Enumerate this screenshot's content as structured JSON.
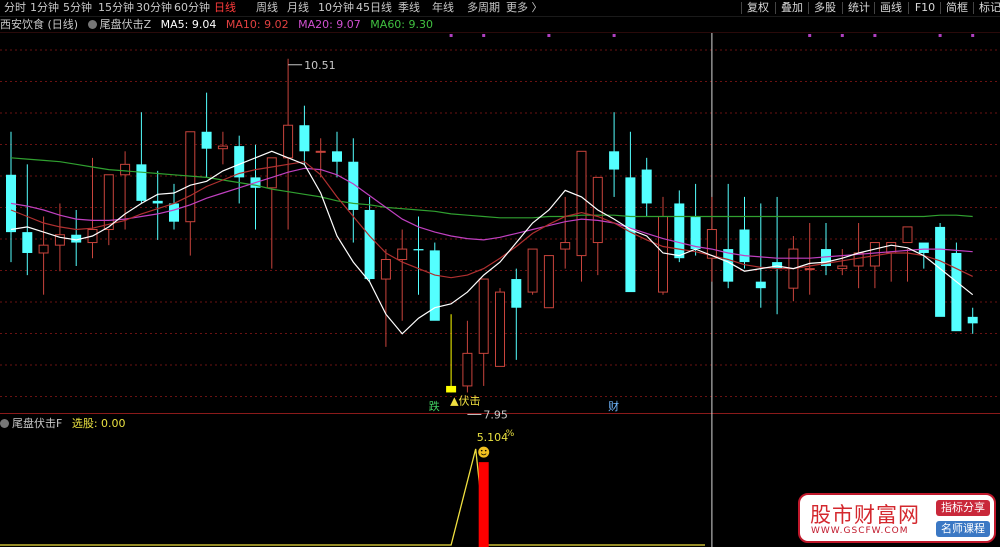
{
  "toolbar": {
    "periods": [
      "分时",
      "1分钟",
      "5分钟",
      "15分钟",
      "30分钟",
      "60分钟",
      "日线",
      "周线",
      "月线",
      "10分钟",
      "45日线",
      "季线",
      "年线",
      "多周期",
      "更多 〉"
    ],
    "active_period": "日线",
    "tools": [
      "复权",
      "叠加",
      "多股",
      "统计",
      "画线",
      "F10",
      "简框",
      "标记"
    ]
  },
  "main_title": {
    "stock": "西安饮食 (日线)",
    "indicator": "尾盘伏击Z",
    "ma5": "MA5: 9.04",
    "ma10": "MA10: 9.02",
    "ma20": "MA20: 9.07",
    "ma60": "MA60: 9.30"
  },
  "sub_title": {
    "indicator": "尾盘伏击F",
    "xg": "选股: 0.00"
  },
  "annotations": {
    "high": "10.51",
    "low": "7.95",
    "signal": "▲伏击",
    "tag_die": "跌",
    "tag_cai": "财",
    "sub_value": "5.104",
    "sub_unit": "%"
  },
  "colors": {
    "up": "#c8443c",
    "down": "#54ffff",
    "signal_bar": "#ffff00",
    "ma5": "#ffffff",
    "ma10": "#b03030",
    "ma20": "#c040c0",
    "ma60": "#30a030",
    "sub_line": "#f0e040",
    "sub_bar": "#ff0000",
    "grid": "#6a1212"
  },
  "logo": {
    "main": "股市财富网",
    "url": "WWW.GSCFW.COM",
    "badge1": "指标分享",
    "badge2": "名师课程"
  },
  "chart_data": {
    "type": "candlestick",
    "x": [
      "c01",
      "c02",
      "c03",
      "c04",
      "c05",
      "c06",
      "c07",
      "c08",
      "c09",
      "c10",
      "c11",
      "c12",
      "c13",
      "c14",
      "c15",
      "c16",
      "c17",
      "c18",
      "c19",
      "c20",
      "c21",
      "c22",
      "c23",
      "c24",
      "c25",
      "c26",
      "c27",
      "c28",
      "c29",
      "c30",
      "c31",
      "c32",
      "c33",
      "c34",
      "c35",
      "c36",
      "c37",
      "c38",
      "c39",
      "c40",
      "c41",
      "c42",
      "c43",
      "c44",
      "c45",
      "c46",
      "c47",
      "c48",
      "c49",
      "c50",
      "c51",
      "c52",
      "c53",
      "c54",
      "c55",
      "c56",
      "c57",
      "c58",
      "c59",
      "c60"
    ],
    "open": [
      9.62,
      9.18,
      9.02,
      9.08,
      9.16,
      9.1,
      9.2,
      9.62,
      9.7,
      9.42,
      9.4,
      9.26,
      9.95,
      9.82,
      9.84,
      9.6,
      9.52,
      9.75,
      10.0,
      9.8,
      9.8,
      9.72,
      9.35,
      8.82,
      8.97,
      9.05,
      9.04,
      7.95,
      8.0,
      8.25,
      8.15,
      8.82,
      8.72,
      8.6,
      9.05,
      9.0,
      9.1,
      9.8,
      9.6,
      9.66,
      8.72,
      9.4,
      9.3,
      8.98,
      9.05,
      9.2,
      8.8,
      8.95,
      8.75,
      8.9,
      9.05,
      8.9,
      8.92,
      8.92,
      9.02,
      9.1,
      9.1,
      9.22,
      9.02,
      8.53
    ],
    "high": [
      9.95,
      9.7,
      9.3,
      9.4,
      9.35,
      9.75,
      9.5,
      9.8,
      10.1,
      9.65,
      9.55,
      9.5,
      10.25,
      9.95,
      9.92,
      9.85,
      9.75,
      10.51,
      10.15,
      9.9,
      9.95,
      9.9,
      9.45,
      9.05,
      9.2,
      9.3,
      9.1,
      8.55,
      8.5,
      8.75,
      8.75,
      8.9,
      8.85,
      9.0,
      9.45,
      9.25,
      9.55,
      10.1,
      9.95,
      9.75,
      9.45,
      9.5,
      9.55,
      9.45,
      9.55,
      9.45,
      9.4,
      9.45,
      9.15,
      9.25,
      9.25,
      9.05,
      9.25,
      9.0,
      9.02,
      9.05,
      9.05,
      9.25,
      9.1,
      8.6
    ],
    "low": [
      8.95,
      8.85,
      8.7,
      8.88,
      8.92,
      8.98,
      9.08,
      9.2,
      9.4,
      9.12,
      9.2,
      9.0,
      9.6,
      9.7,
      9.4,
      9.2,
      8.9,
      9.2,
      9.7,
      9.6,
      9.6,
      9.1,
      8.8,
      8.3,
      8.5,
      8.7,
      8.8,
      7.95,
      7.95,
      8.0,
      8.15,
      8.2,
      8.7,
      8.65,
      8.9,
      8.8,
      8.85,
      9.45,
      9.2,
      9.3,
      8.7,
      8.95,
      9.0,
      8.8,
      8.75,
      8.9,
      8.6,
      8.55,
      8.65,
      8.7,
      8.85,
      8.85,
      8.75,
      8.75,
      8.8,
      8.8,
      8.9,
      8.9,
      8.55,
      8.4
    ],
    "close": [
      9.18,
      9.02,
      9.08,
      9.16,
      9.1,
      9.2,
      9.62,
      9.7,
      9.42,
      9.4,
      9.26,
      9.95,
      9.82,
      9.84,
      9.6,
      9.52,
      9.75,
      10.0,
      9.8,
      9.8,
      9.72,
      9.35,
      8.82,
      8.97,
      9.05,
      9.04,
      8.5,
      8.0,
      8.25,
      8.82,
      8.72,
      8.6,
      9.05,
      9.0,
      9.1,
      9.8,
      9.6,
      9.66,
      8.72,
      9.4,
      9.3,
      8.98,
      9.05,
      9.2,
      8.8,
      8.95,
      8.75,
      8.9,
      9.05,
      8.9,
      8.92,
      8.92,
      9.02,
      9.1,
      9.1,
      9.22,
      9.02,
      8.53,
      8.42,
      8.48
    ],
    "ma5": [
      9.2,
      9.22,
      9.18,
      9.14,
      9.12,
      9.15,
      9.22,
      9.32,
      9.4,
      9.47,
      9.48,
      9.54,
      9.57,
      9.65,
      9.7,
      9.75,
      9.8,
      9.75,
      9.7,
      9.48,
      9.15,
      8.95,
      8.8,
      8.55,
      8.4,
      8.52,
      8.6,
      8.63,
      8.72,
      8.85,
      8.95,
      9.1,
      9.25,
      9.35,
      9.5,
      9.45,
      9.35,
      9.28,
      9.2,
      9.15,
      9.02,
      9.0,
      9.05,
      9.0,
      8.95,
      8.88,
      8.9,
      8.92,
      8.9,
      8.94,
      8.95,
      8.98,
      9.02,
      9.05,
      9.08,
      9.06,
      9.0,
      8.9,
      8.8,
      8.7
    ],
    "ma10": [
      9.35,
      9.3,
      9.25,
      9.22,
      9.2,
      9.21,
      9.24,
      9.27,
      9.32,
      9.36,
      9.4,
      9.46,
      9.53,
      9.58,
      9.63,
      9.66,
      9.68,
      9.7,
      9.72,
      9.62,
      9.45,
      9.3,
      9.15,
      9.02,
      8.95,
      8.9,
      8.85,
      8.83,
      8.85,
      8.9,
      8.98,
      9.07,
      9.17,
      9.24,
      9.3,
      9.33,
      9.3,
      9.25,
      9.18,
      9.12,
      9.07,
      9.05,
      9.03,
      9.0,
      8.97,
      8.93,
      8.91,
      8.9,
      8.9,
      8.92,
      8.94,
      8.96,
      8.98,
      9.0,
      9.02,
      9.02,
      9.0,
      8.96,
      8.9,
      8.84
    ],
    "ma20": [
      9.4,
      9.38,
      9.35,
      9.31,
      9.28,
      9.27,
      9.27,
      9.28,
      9.3,
      9.32,
      9.35,
      9.39,
      9.44,
      9.48,
      9.52,
      9.56,
      9.6,
      9.64,
      9.67,
      9.66,
      9.62,
      9.55,
      9.46,
      9.37,
      9.28,
      9.22,
      9.18,
      9.15,
      9.13,
      9.12,
      9.14,
      9.17,
      9.2,
      9.23,
      9.26,
      9.28,
      9.27,
      9.25,
      9.21,
      9.17,
      9.13,
      9.1,
      9.07,
      9.05,
      9.02,
      9.0,
      8.99,
      8.98,
      8.98,
      8.98,
      8.99,
      9.0,
      9.01,
      9.02,
      9.03,
      9.04,
      9.05,
      9.05,
      9.04,
      9.03
    ],
    "ma60": [
      9.75,
      9.74,
      9.73,
      9.72,
      9.7,
      9.68,
      9.66,
      9.65,
      9.64,
      9.63,
      9.62,
      9.61,
      9.6,
      9.58,
      9.56,
      9.54,
      9.51,
      9.49,
      9.47,
      9.45,
      9.42,
      9.4,
      9.39,
      9.37,
      9.36,
      9.35,
      9.34,
      9.32,
      9.31,
      9.3,
      9.29,
      9.29,
      9.29,
      9.3,
      9.3,
      9.31,
      9.31,
      9.31,
      9.3,
      9.3,
      9.3,
      9.3,
      9.3,
      9.3,
      9.3,
      9.3,
      9.3,
      9.3,
      9.3,
      9.3,
      9.3,
      9.3,
      9.3,
      9.3,
      9.3,
      9.3,
      9.3,
      9.31,
      9.31,
      9.3
    ],
    "signal_index": 27,
    "crosshair_index": 43,
    "high_index": 17,
    "low_index": 28,
    "tag_die_index": 26,
    "tag_cai_index": 37,
    "markers_top": [
      27,
      29,
      33,
      37,
      49,
      51,
      53,
      57,
      59,
      61
    ],
    "y_range": [
      7.8,
      10.7
    ],
    "sub_line": {
      "x_start": 27,
      "x_peak": 29,
      "x_end": 30,
      "values": [
        0,
        0,
        5.104,
        0,
        0
      ],
      "bar_index": 29,
      "bar_value": 4.4,
      "y_range": [
        0,
        6.0
      ]
    }
  }
}
